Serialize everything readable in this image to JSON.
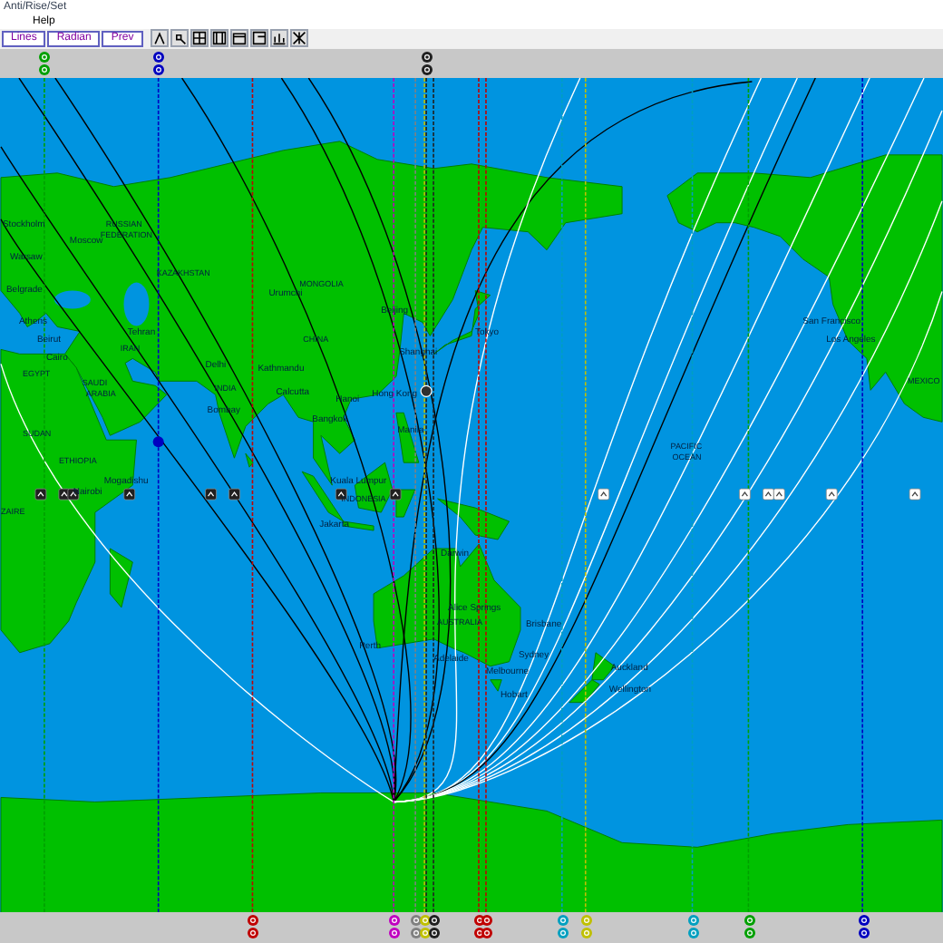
{
  "window": {
    "title": "Anti/Rise/Set"
  },
  "menu": [
    "Help"
  ],
  "toolbar": {
    "buttons": [
      "Lines",
      "Radian",
      "Prev"
    ]
  },
  "top_markers": [
    {
      "color": "#00a000"
    },
    {
      "color": "#0000c0"
    },
    {
      "color": "#202020"
    }
  ],
  "map": {
    "labels": [
      {
        "text": "Stockholm",
        "kind": "city"
      },
      {
        "text": "Moscow",
        "kind": "city"
      },
      {
        "text": "RUSSIAN",
        "kind": "country"
      },
      {
        "text": "FEDERATION",
        "kind": "country"
      },
      {
        "text": "Warsaw",
        "kind": "city"
      },
      {
        "text": "Belgrade",
        "kind": "city"
      },
      {
        "text": "Athens",
        "kind": "city"
      },
      {
        "text": "Beirut",
        "kind": "city"
      },
      {
        "text": "Tehran",
        "kind": "city"
      },
      {
        "text": "IRAN",
        "kind": "country"
      },
      {
        "text": "KAZAKHSTAN",
        "kind": "country"
      },
      {
        "text": "Cairo",
        "kind": "city"
      },
      {
        "text": "EGYPT",
        "kind": "country"
      },
      {
        "text": "SAUDI",
        "kind": "country"
      },
      {
        "text": "ARABIA",
        "kind": "country"
      },
      {
        "text": "SUDAN",
        "kind": "country"
      },
      {
        "text": "ETHIOPIA",
        "kind": "country"
      },
      {
        "text": "Delhi",
        "kind": "city"
      },
      {
        "text": "INDIA",
        "kind": "country"
      },
      {
        "text": "Bombay",
        "kind": "city"
      },
      {
        "text": "Urumchi",
        "kind": "city"
      },
      {
        "text": "Kathmandu",
        "kind": "city"
      },
      {
        "text": "Calcutta",
        "kind": "city"
      },
      {
        "text": "MONGOLIA",
        "kind": "country"
      },
      {
        "text": "CHINA",
        "kind": "country"
      },
      {
        "text": "Beijing",
        "kind": "city"
      },
      {
        "text": "Shanghai",
        "kind": "city"
      },
      {
        "text": "Hong Kong",
        "kind": "city"
      },
      {
        "text": "Hanoi",
        "kind": "city"
      },
      {
        "text": "Bangkok",
        "kind": "city"
      },
      {
        "text": "Manila",
        "kind": "city"
      },
      {
        "text": "Tokyo",
        "kind": "city"
      },
      {
        "text": "Kuala Lumpur",
        "kind": "city"
      },
      {
        "text": "INDONESIA",
        "kind": "country"
      },
      {
        "text": "Jakarta",
        "kind": "city"
      },
      {
        "text": "Mogadishu",
        "kind": "city"
      },
      {
        "text": "Nairobi",
        "kind": "city"
      },
      {
        "text": "ZAIRE",
        "kind": "country"
      },
      {
        "text": "Darwin",
        "kind": "city"
      },
      {
        "text": "Alice Springs",
        "kind": "city"
      },
      {
        "text": "AUSTRALIA",
        "kind": "country"
      },
      {
        "text": "Perth",
        "kind": "city"
      },
      {
        "text": "Adelaide",
        "kind": "city"
      },
      {
        "text": "Brisbane",
        "kind": "city"
      },
      {
        "text": "Sydney",
        "kind": "city"
      },
      {
        "text": "Melbourne",
        "kind": "city"
      },
      {
        "text": "Hobart",
        "kind": "city"
      },
      {
        "text": "Auckland",
        "kind": "city"
      },
      {
        "text": "Wellington",
        "kind": "city"
      },
      {
        "text": "PACIFIC",
        "kind": "country"
      },
      {
        "text": "OCEAN",
        "kind": "country"
      },
      {
        "text": "San Francisco",
        "kind": "city"
      },
      {
        "text": "Los Angeles",
        "kind": "city"
      },
      {
        "text": "MEXICO",
        "kind": "country"
      }
    ],
    "equator_markers": [
      {
        "kind": "dark"
      },
      {
        "kind": "dark"
      },
      {
        "kind": "dark"
      },
      {
        "kind": "dark"
      },
      {
        "kind": "dark"
      },
      {
        "kind": "dark"
      },
      {
        "kind": "dark"
      },
      {
        "kind": "dark"
      },
      {
        "kind": "light"
      },
      {
        "kind": "light"
      },
      {
        "kind": "light"
      },
      {
        "kind": "light"
      },
      {
        "kind": "light"
      },
      {
        "kind": "light"
      }
    ]
  },
  "bottom_markers": [
    {
      "color": "#c00000"
    },
    {
      "color": "#c000c0"
    },
    {
      "color": "#808080"
    },
    {
      "color": "#c0c000"
    },
    {
      "color": "#202020"
    },
    {
      "color": "#c00000"
    },
    {
      "color": "#c00000"
    },
    {
      "color": "#00a0c0"
    },
    {
      "color": "#c0c000"
    },
    {
      "color": "#00a0c0"
    },
    {
      "color": "#00a000"
    },
    {
      "color": "#0000c0"
    }
  ]
}
